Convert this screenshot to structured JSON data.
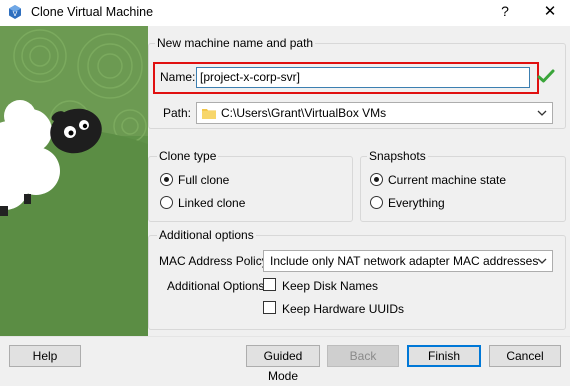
{
  "window": {
    "title": "Clone Virtual Machine",
    "help_glyph": "?",
    "close_glyph": "✕"
  },
  "name_path": {
    "group_title": "New machine name and path",
    "name_label": "Name:",
    "name_value": "[project-x-corp-svr]",
    "path_label": "Path:",
    "path_value": "C:\\Users\\Grant\\VirtualBox VMs"
  },
  "clone_type": {
    "group_title": "Clone type",
    "options": [
      {
        "label": "Full clone",
        "selected": true
      },
      {
        "label": "Linked clone",
        "selected": false
      }
    ]
  },
  "snapshots": {
    "group_title": "Snapshots",
    "options": [
      {
        "label": "Current machine state",
        "selected": true
      },
      {
        "label": "Everything",
        "selected": false
      }
    ]
  },
  "additional": {
    "group_title": "Additional options",
    "mac_label": "MAC Address Policy:",
    "mac_value": "Include only NAT network adapter MAC addresses",
    "options_label": "Additional Options:",
    "keep_disk_names": "Keep Disk Names",
    "keep_hw_uuids": "Keep Hardware UUIDs"
  },
  "buttons": {
    "help": "Help",
    "guided_mode": "Guided Mode",
    "back": "Back",
    "finish": "Finish",
    "cancel": "Cancel"
  },
  "icons": {
    "app": "virtualbox-icon",
    "check": "green-check-icon",
    "folder": "folder-icon",
    "chevron": "chevron-down-icon"
  },
  "colors": {
    "highlight_border": "#e01010",
    "art_green": "#5f9248",
    "accent": "#0078d7",
    "check_green": "#3aa53a"
  }
}
